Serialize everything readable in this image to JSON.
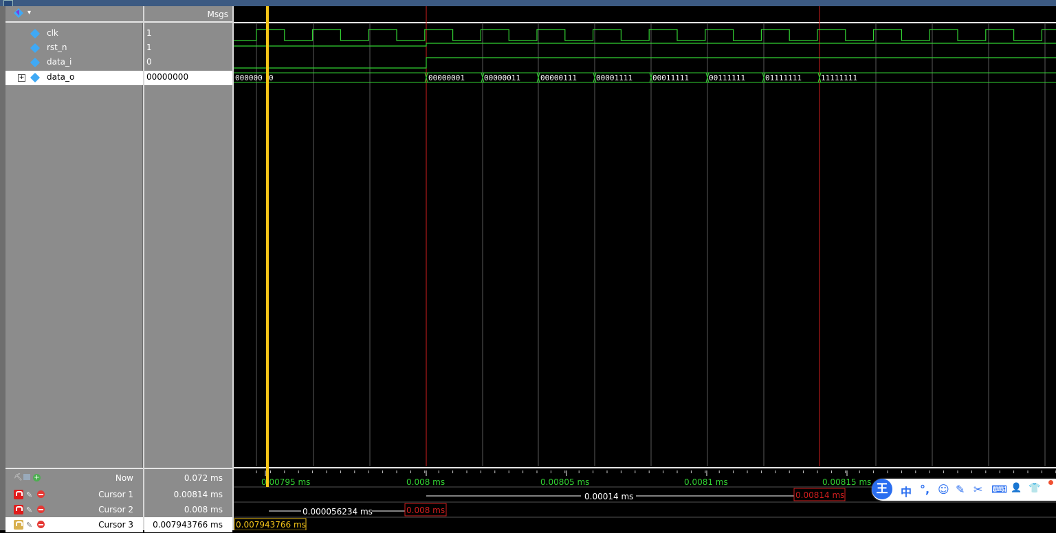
{
  "header": {
    "msgs_label": "Msgs"
  },
  "signals": [
    {
      "name": "clk",
      "value": "1"
    },
    {
      "name": "rst_n",
      "value": "1"
    },
    {
      "name": "data_i",
      "value": "0"
    },
    {
      "name": "data_o",
      "value": "00000000"
    }
  ],
  "cursors": {
    "now": {
      "label": "Now",
      "value": "0.072 ms"
    },
    "cursor1": {
      "label": "Cursor 1",
      "value": "0.00814 ms"
    },
    "cursor2": {
      "label": "Cursor 2",
      "value": "0.008 ms"
    },
    "cursor3": {
      "label": "Cursor 3",
      "value": "0.007943766 ms"
    }
  },
  "timeline": {
    "ticks": [
      "0.00795 ms",
      "0.008 ms",
      "0.00805 ms",
      "0.0081 ms",
      "0.00815 ms"
    ],
    "delta_c1_c2": "0.00014 ms",
    "delta_c2_c3": "0.000056234 ms",
    "cursor1_tag": "0.00814 ms",
    "cursor2_tag": "0.008 ms",
    "cursor3_tag": "0.007943766 ms"
  },
  "bus_values": [
    "000000",
    "0",
    "00000001",
    "00000011",
    "00000111",
    "00001111",
    "00011111",
    "00111111",
    "01111111",
    "11111111"
  ],
  "colors": {
    "signal_wave": "#32d232",
    "cursor_active": "#f5c518",
    "cursor_red": "#d21e1e",
    "grid": "#5a5a5a",
    "panel_gray": "#8c8c8c",
    "signal_icon": "#3fa9f5"
  },
  "ime": {
    "logo": "王",
    "items": [
      "中",
      "°,",
      "☺",
      "✎",
      "✂",
      "⌨",
      "👤",
      "👕"
    ]
  }
}
